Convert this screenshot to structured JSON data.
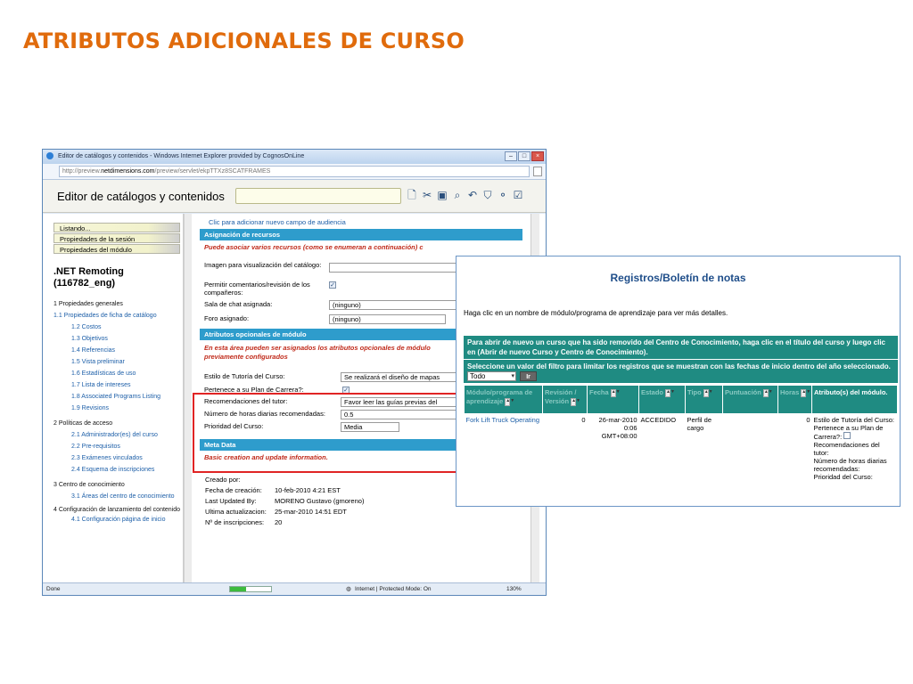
{
  "slide": {
    "title": "ATRIBUTOS ADICIONALES DE CURSO"
  },
  "browser": {
    "window_title": "Editor de catálogos y contenidos - Windows Internet Explorer provided by CognosOnLine",
    "url_prefix": "http://preview.",
    "url_host": "netdimensions.com",
    "url_path": "/preview/servlet/ekpTTXz8SCATFRAMES",
    "status_left": "Done",
    "status_zone": "Internet | Protected Mode: On",
    "zoom": "130%"
  },
  "app": {
    "title": "Editor de catálogos y contenidos"
  },
  "sidebar": {
    "tabs": [
      "Listando...",
      "Propiedades de la sesión",
      "Propiedades del módulo"
    ],
    "heading": ".NET Remoting (116782_eng)",
    "nav": [
      {
        "label": "1 Propiedades generales",
        "level": 0
      },
      {
        "label": "1.1 Propiedades de ficha de catálogo",
        "level": 1,
        "multi": true,
        "first": true
      },
      {
        "label": "1.2 Costos",
        "level": 1
      },
      {
        "label": "1.3 Objetivos",
        "level": 1
      },
      {
        "label": "1.4 Referencias",
        "level": 1
      },
      {
        "label": "1.5 Vista preliminar",
        "level": 1
      },
      {
        "label": "1.6 Estadísticas de uso",
        "level": 1
      },
      {
        "label": "1.7 Lista de intereses",
        "level": 1
      },
      {
        "label": "1.8 Associated Programs Listing",
        "level": 1
      },
      {
        "label": "1.9 Revisions",
        "level": 1
      },
      {
        "label": "2 Políticas de acceso",
        "level": 0
      },
      {
        "label": "2.1 Administrador(es) del curso",
        "level": 1
      },
      {
        "label": "2.2 Pre-requisitos",
        "level": 1
      },
      {
        "label": "2.3 Exámenes vinculados",
        "level": 1
      },
      {
        "label": "2.4 Esquema de inscripciones",
        "level": 1
      },
      {
        "label": "3 Centro de conocimiento",
        "level": 0
      },
      {
        "label": "3.1 Áreas del centro de conocimiento",
        "level": 1,
        "multi": true
      },
      {
        "label": "4 Configuración de lanzamiento del contenido",
        "level": 0,
        "multi": true
      },
      {
        "label": "4.1 Configuración página de inicio",
        "level": 1,
        "multi": true
      }
    ]
  },
  "main": {
    "audience_link": "Clic para adicionar nuevo campo de audiencia",
    "resources_header": "Asignación de recursos",
    "resources_note": "Puede asociar varios recursos (como se enumeran a continuación) c",
    "fields": {
      "image_label": "Imagen para visualización del catálogo:",
      "comments_label": "Permitir comentarios/revisión de los compañeros:",
      "chat_label": "Sala de chat asignada:",
      "chat_value": "(ninguno)",
      "forum_label": "Foro asignado:",
      "forum_value": "(ninguno)"
    },
    "optional_header": "Atributos opcionales de módulo",
    "optional_note_1": "En esta área pueden ser asignados los atributos opcionales de módulo",
    "optional_note_2": "previamente configurados",
    "attributes": {
      "tutoring_label": "Estilo de Tutoría del Curso:",
      "tutoring_value": "Se realizará el diseño de mapas",
      "career_label": "Pertenece a su Plan de Carrera?:",
      "tutor_label": "Recomendaciones del tutor:",
      "tutor_value": "Favor leer las guías previas del",
      "hours_label": "Número de horas diarias recomendadas:",
      "hours_value": "0.5",
      "priority_label": "Prioridad del Curso:",
      "priority_value": "Media"
    },
    "meta_header": "Meta Data",
    "meta_note": "Basic creation and update information.",
    "meta": {
      "created_by_label": "Creado por:",
      "created_date_label": "Fecha de creación:",
      "created_date": "10-feb-2010 4:21 EST",
      "updated_by_label": "Last Updated By:",
      "updated_by": "MORENO Gustavo (gmoreno)",
      "last_update_label": "Ultima actualizacion:",
      "last_update": "25-mar-2010 14:51 EDT",
      "enrollments_label": "Nº de inscripciones:",
      "enrollments": "20"
    }
  },
  "panel": {
    "title": "Registros/Boletín de notas",
    "instruction": "Haga clic en un nombre de módulo/programa de aprendizaje para ver más detalles.",
    "reopen_note": "Para abrir de nuevo un curso que ha sido removido del Centro de Conocimiento, haga clic en el título del curso y luego clic en (Abrir de nuevo Curso y Centro de Conocimiento).",
    "filter_note": "Seleccione un valor del filtro para limitar los registros que se muestran con las fechas de inicio dentro del año seleccionado.",
    "filter_value": "Todo",
    "go_label": "Ir",
    "columns": [
      "Módulo/programa de aprendizaje",
      "Revisión / Versión",
      "Fecha",
      "Estado",
      "Tipo",
      "Puntuación",
      "Horas",
      "Atributo(s) del módulo."
    ],
    "row": {
      "module": "Fork Lift Truck Operating",
      "revision": "0",
      "date": "26-mar-2010 0:06 GMT+08:00",
      "status": "ACCEDIDO",
      "type": "Perfil de cargo",
      "score": "",
      "hours": "0",
      "attr_1": "Estilo de Tutoría del Curso:",
      "attr_2": "Pertenece a su Plan de Carrera?:",
      "attr_3": "Recomendaciones del tutor:",
      "attr_4": "Número de horas diarias recomendadas:",
      "attr_5": "Prioridad del Curso:"
    }
  }
}
